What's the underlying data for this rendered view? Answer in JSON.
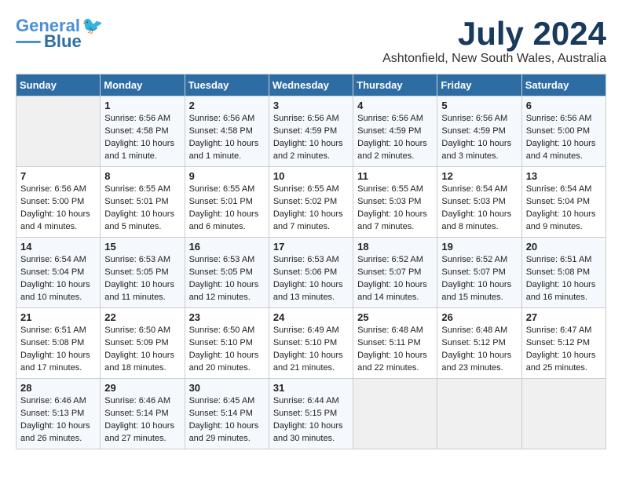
{
  "logo": {
    "line1": "General",
    "line2": "Blue"
  },
  "title": "July 2024",
  "location": "Ashtonfield, New South Wales, Australia",
  "days_of_week": [
    "Sunday",
    "Monday",
    "Tuesday",
    "Wednesday",
    "Thursday",
    "Friday",
    "Saturday"
  ],
  "weeks": [
    [
      {
        "day": "",
        "sunrise": "",
        "sunset": "",
        "daylight": ""
      },
      {
        "day": "1",
        "sunrise": "Sunrise: 6:56 AM",
        "sunset": "Sunset: 4:58 PM",
        "daylight": "Daylight: 10 hours and 1 minute."
      },
      {
        "day": "2",
        "sunrise": "Sunrise: 6:56 AM",
        "sunset": "Sunset: 4:58 PM",
        "daylight": "Daylight: 10 hours and 1 minute."
      },
      {
        "day": "3",
        "sunrise": "Sunrise: 6:56 AM",
        "sunset": "Sunset: 4:59 PM",
        "daylight": "Daylight: 10 hours and 2 minutes."
      },
      {
        "day": "4",
        "sunrise": "Sunrise: 6:56 AM",
        "sunset": "Sunset: 4:59 PM",
        "daylight": "Daylight: 10 hours and 2 minutes."
      },
      {
        "day": "5",
        "sunrise": "Sunrise: 6:56 AM",
        "sunset": "Sunset: 4:59 PM",
        "daylight": "Daylight: 10 hours and 3 minutes."
      },
      {
        "day": "6",
        "sunrise": "Sunrise: 6:56 AM",
        "sunset": "Sunset: 5:00 PM",
        "daylight": "Daylight: 10 hours and 4 minutes."
      }
    ],
    [
      {
        "day": "7",
        "sunrise": "Sunrise: 6:56 AM",
        "sunset": "Sunset: 5:00 PM",
        "daylight": "Daylight: 10 hours and 4 minutes."
      },
      {
        "day": "8",
        "sunrise": "Sunrise: 6:55 AM",
        "sunset": "Sunset: 5:01 PM",
        "daylight": "Daylight: 10 hours and 5 minutes."
      },
      {
        "day": "9",
        "sunrise": "Sunrise: 6:55 AM",
        "sunset": "Sunset: 5:01 PM",
        "daylight": "Daylight: 10 hours and 6 minutes."
      },
      {
        "day": "10",
        "sunrise": "Sunrise: 6:55 AM",
        "sunset": "Sunset: 5:02 PM",
        "daylight": "Daylight: 10 hours and 7 minutes."
      },
      {
        "day": "11",
        "sunrise": "Sunrise: 6:55 AM",
        "sunset": "Sunset: 5:03 PM",
        "daylight": "Daylight: 10 hours and 7 minutes."
      },
      {
        "day": "12",
        "sunrise": "Sunrise: 6:54 AM",
        "sunset": "Sunset: 5:03 PM",
        "daylight": "Daylight: 10 hours and 8 minutes."
      },
      {
        "day": "13",
        "sunrise": "Sunrise: 6:54 AM",
        "sunset": "Sunset: 5:04 PM",
        "daylight": "Daylight: 10 hours and 9 minutes."
      }
    ],
    [
      {
        "day": "14",
        "sunrise": "Sunrise: 6:54 AM",
        "sunset": "Sunset: 5:04 PM",
        "daylight": "Daylight: 10 hours and 10 minutes."
      },
      {
        "day": "15",
        "sunrise": "Sunrise: 6:53 AM",
        "sunset": "Sunset: 5:05 PM",
        "daylight": "Daylight: 10 hours and 11 minutes."
      },
      {
        "day": "16",
        "sunrise": "Sunrise: 6:53 AM",
        "sunset": "Sunset: 5:05 PM",
        "daylight": "Daylight: 10 hours and 12 minutes."
      },
      {
        "day": "17",
        "sunrise": "Sunrise: 6:53 AM",
        "sunset": "Sunset: 5:06 PM",
        "daylight": "Daylight: 10 hours and 13 minutes."
      },
      {
        "day": "18",
        "sunrise": "Sunrise: 6:52 AM",
        "sunset": "Sunset: 5:07 PM",
        "daylight": "Daylight: 10 hours and 14 minutes."
      },
      {
        "day": "19",
        "sunrise": "Sunrise: 6:52 AM",
        "sunset": "Sunset: 5:07 PM",
        "daylight": "Daylight: 10 hours and 15 minutes."
      },
      {
        "day": "20",
        "sunrise": "Sunrise: 6:51 AM",
        "sunset": "Sunset: 5:08 PM",
        "daylight": "Daylight: 10 hours and 16 minutes."
      }
    ],
    [
      {
        "day": "21",
        "sunrise": "Sunrise: 6:51 AM",
        "sunset": "Sunset: 5:08 PM",
        "daylight": "Daylight: 10 hours and 17 minutes."
      },
      {
        "day": "22",
        "sunrise": "Sunrise: 6:50 AM",
        "sunset": "Sunset: 5:09 PM",
        "daylight": "Daylight: 10 hours and 18 minutes."
      },
      {
        "day": "23",
        "sunrise": "Sunrise: 6:50 AM",
        "sunset": "Sunset: 5:10 PM",
        "daylight": "Daylight: 10 hours and 20 minutes."
      },
      {
        "day": "24",
        "sunrise": "Sunrise: 6:49 AM",
        "sunset": "Sunset: 5:10 PM",
        "daylight": "Daylight: 10 hours and 21 minutes."
      },
      {
        "day": "25",
        "sunrise": "Sunrise: 6:48 AM",
        "sunset": "Sunset: 5:11 PM",
        "daylight": "Daylight: 10 hours and 22 minutes."
      },
      {
        "day": "26",
        "sunrise": "Sunrise: 6:48 AM",
        "sunset": "Sunset: 5:12 PM",
        "daylight": "Daylight: 10 hours and 23 minutes."
      },
      {
        "day": "27",
        "sunrise": "Sunrise: 6:47 AM",
        "sunset": "Sunset: 5:12 PM",
        "daylight": "Daylight: 10 hours and 25 minutes."
      }
    ],
    [
      {
        "day": "28",
        "sunrise": "Sunrise: 6:46 AM",
        "sunset": "Sunset: 5:13 PM",
        "daylight": "Daylight: 10 hours and 26 minutes."
      },
      {
        "day": "29",
        "sunrise": "Sunrise: 6:46 AM",
        "sunset": "Sunset: 5:14 PM",
        "daylight": "Daylight: 10 hours and 27 minutes."
      },
      {
        "day": "30",
        "sunrise": "Sunrise: 6:45 AM",
        "sunset": "Sunset: 5:14 PM",
        "daylight": "Daylight: 10 hours and 29 minutes."
      },
      {
        "day": "31",
        "sunrise": "Sunrise: 6:44 AM",
        "sunset": "Sunset: 5:15 PM",
        "daylight": "Daylight: 10 hours and 30 minutes."
      },
      {
        "day": "",
        "sunrise": "",
        "sunset": "",
        "daylight": ""
      },
      {
        "day": "",
        "sunrise": "",
        "sunset": "",
        "daylight": ""
      },
      {
        "day": "",
        "sunrise": "",
        "sunset": "",
        "daylight": ""
      }
    ]
  ]
}
